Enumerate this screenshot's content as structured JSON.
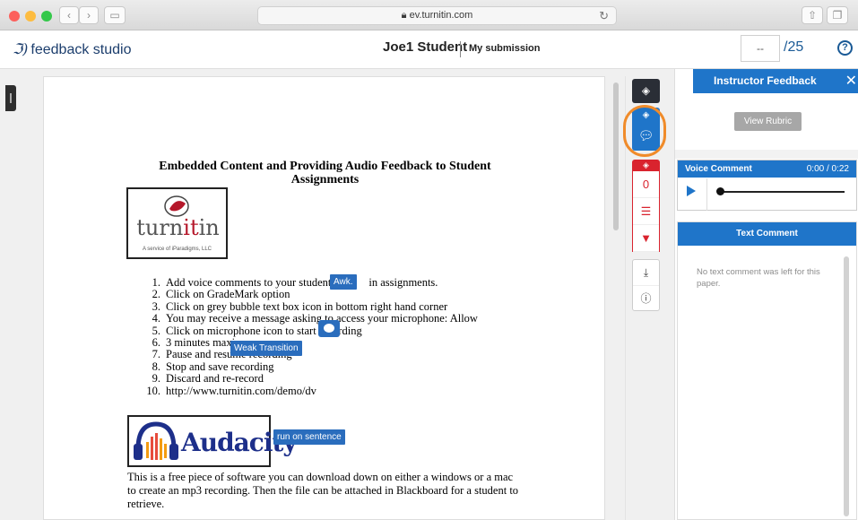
{
  "browser": {
    "url": "ev.turnitin.com",
    "back": "‹",
    "forward": "›"
  },
  "app": {
    "product": "feedback studio",
    "student": "Joe1 Student",
    "submission_label": "My submission",
    "score_value": "--",
    "score_total": "/25",
    "help": "?"
  },
  "document": {
    "title": "Embedded Content and Providing Audio Feedback to Student Assignments",
    "logo_turnitin_a": "turn",
    "logo_turnitin_b": "it",
    "logo_turnitin_c": "in",
    "logo_turnitin_sub": "A service of iParadigms, LLC",
    "logo_audacity": "Audacity",
    "list": [
      "Add voice comments to your students",
      "Click on GradeMark option",
      "Click on grey bubble text box icon in bottom right hand corner",
      "You may receive a message asking to access your microphone: Allow",
      "Click on microphone icon to start recording",
      "3 minutes maximum",
      "Pause and resume recording",
      "Stop and save recording",
      "Discard and re-record",
      "http://www.turnitin.com/demo/dv"
    ],
    "list_tail_1": " in assignments.",
    "paragraph": "This is a free piece of software you can download down on either a windows or a mac to create an mp3 recording. Then the file can be attached in Blackboard for a student to retrieve."
  },
  "quickmarks": {
    "awk": "Awk.",
    "weak_transition": "Weak Transition",
    "run_on": "run on sentence"
  },
  "toolbar": {
    "similarity_count": "0"
  },
  "panel": {
    "title": "Instructor Feedback",
    "close": "✕",
    "rubric_button": "View Rubric",
    "voice_comment_label": "Voice Comment",
    "voice_time": "0:00 / 0:22",
    "text_comment_label": "Text Comment",
    "text_comment_empty": "No text comment was left for this paper."
  },
  "colors": {
    "brand_blue": "#1f75c9",
    "highlight_ring": "#f08b2a",
    "similarity_red": "#d9232e"
  }
}
